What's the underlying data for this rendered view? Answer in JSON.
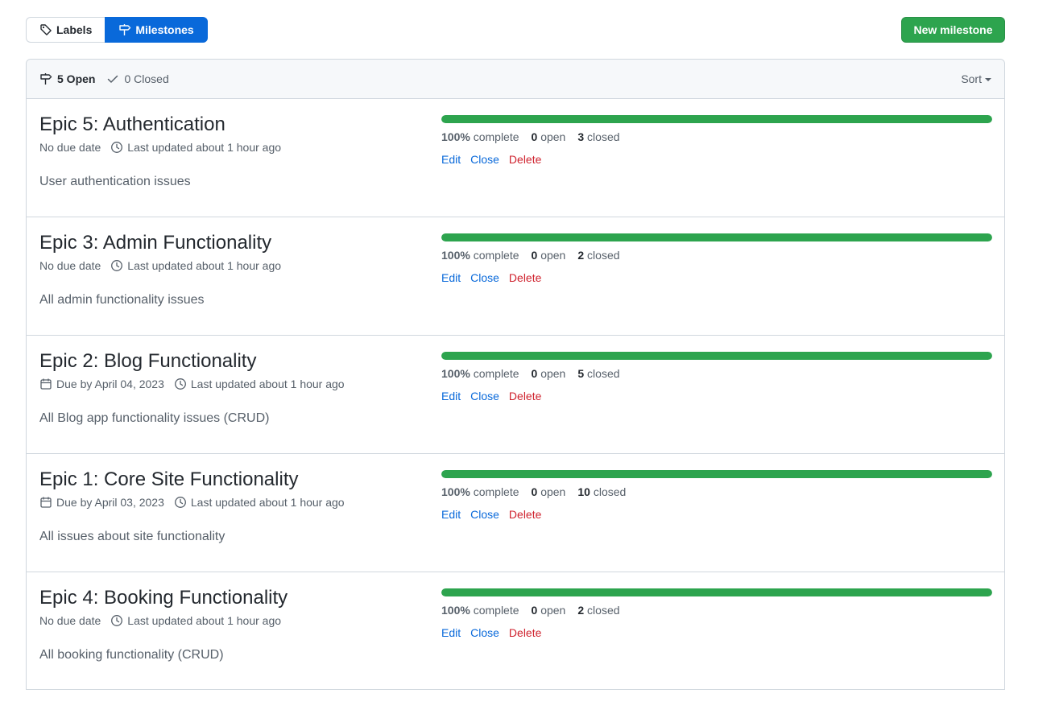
{
  "subnav": {
    "labels": "Labels",
    "milestones": "Milestones"
  },
  "new_milestone": "New milestone",
  "header": {
    "open": "5 Open",
    "closed": "0 Closed",
    "sort": "Sort"
  },
  "colors": {
    "accent_blue": "#0969da",
    "primary_green": "#2da44e",
    "danger_red": "#cf222e"
  },
  "actions": {
    "edit": "Edit",
    "close": "Close",
    "delete": "Delete"
  },
  "milestones": [
    {
      "title": "Epic 5: Authentication",
      "due": "No due date",
      "updated": "Last updated about 1 hour ago",
      "description": "User authentication issues",
      "progress": 100,
      "percent": "100%",
      "complete_label": "complete",
      "open_count": "0",
      "open_label": "open",
      "closed_count": "3",
      "closed_label": "closed"
    },
    {
      "title": "Epic 3: Admin Functionality",
      "due": "No due date",
      "updated": "Last updated about 1 hour ago",
      "description": "All admin functionality issues",
      "progress": 100,
      "percent": "100%",
      "complete_label": "complete",
      "open_count": "0",
      "open_label": "open",
      "closed_count": "2",
      "closed_label": "closed"
    },
    {
      "title": "Epic 2: Blog Functionality",
      "due": "Due by April 04, 2023",
      "updated": "Last updated about 1 hour ago",
      "description": "All Blog app functionality issues (CRUD)",
      "progress": 100,
      "percent": "100%",
      "complete_label": "complete",
      "open_count": "0",
      "open_label": "open",
      "closed_count": "5",
      "closed_label": "closed"
    },
    {
      "title": "Epic 1: Core Site Functionality",
      "due": "Due by April 03, 2023",
      "updated": "Last updated about 1 hour ago",
      "description": "All issues about site functionality",
      "progress": 100,
      "percent": "100%",
      "complete_label": "complete",
      "open_count": "0",
      "open_label": "open",
      "closed_count": "10",
      "closed_label": "closed"
    },
    {
      "title": "Epic 4: Booking Functionality",
      "due": "No due date",
      "updated": "Last updated about 1 hour ago",
      "description": "All booking functionality (CRUD)",
      "progress": 100,
      "percent": "100%",
      "complete_label": "complete",
      "open_count": "0",
      "open_label": "open",
      "closed_count": "2",
      "closed_label": "closed"
    }
  ]
}
